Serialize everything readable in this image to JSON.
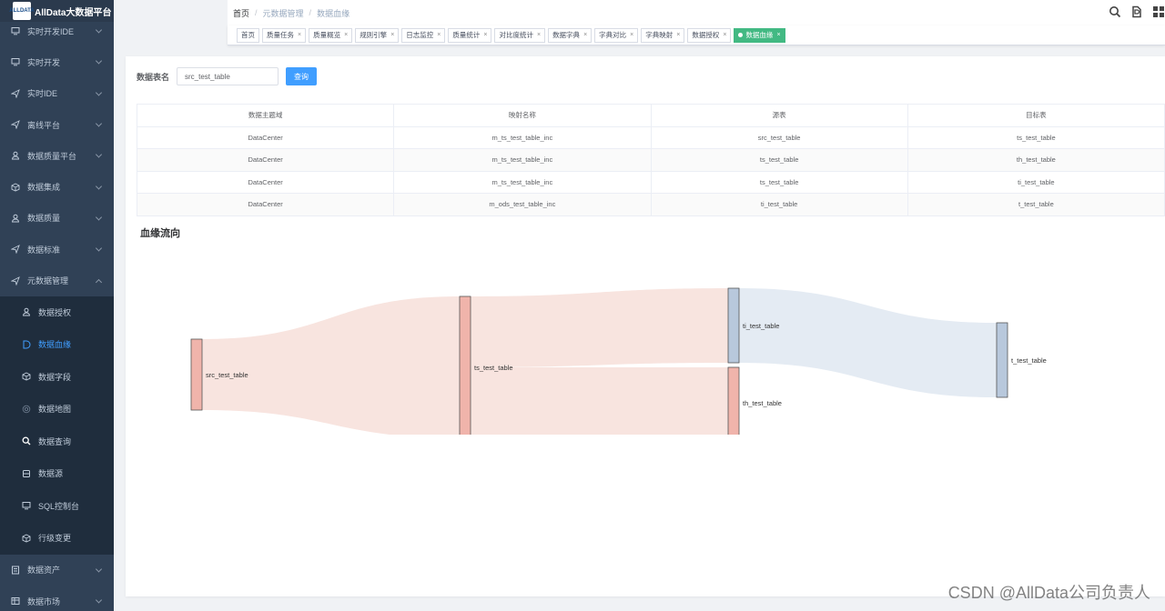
{
  "app": {
    "title": "AllData大数据平台",
    "logo_text": "ALLDATA"
  },
  "sidebar": {
    "items": [
      {
        "label": "实时开发IDE",
        "icon": "monitor-icon"
      },
      {
        "label": "实时开发",
        "icon": "monitor-icon"
      },
      {
        "label": "实时IDE",
        "icon": "send-icon"
      },
      {
        "label": "离线平台",
        "icon": "send-icon"
      },
      {
        "label": "数据质量平台",
        "icon": "user-icon"
      },
      {
        "label": "数据集成",
        "icon": "cube-icon"
      },
      {
        "label": "数据质量",
        "icon": "user-icon"
      },
      {
        "label": "数据标准",
        "icon": "send-icon"
      },
      {
        "label": "元数据管理",
        "icon": "send-icon",
        "expanded": true
      }
    ],
    "submenu": [
      {
        "label": "数据授权",
        "icon": "user-icon"
      },
      {
        "label": "数据血缘",
        "icon": "d-icon",
        "active": true
      },
      {
        "label": "数据字段",
        "icon": "cube-icon"
      },
      {
        "label": "数据地图",
        "icon": "globe-icon"
      },
      {
        "label": "数据查询",
        "icon": "search-icon"
      },
      {
        "label": "数据源",
        "icon": "database-icon"
      },
      {
        "label": "SQL控制台",
        "icon": "monitor-icon"
      },
      {
        "label": "行级变更",
        "icon": "cube-icon"
      }
    ],
    "bottom_items": [
      {
        "label": "数据资产",
        "icon": "list-icon"
      },
      {
        "label": "数据市场",
        "icon": "table-icon"
      }
    ]
  },
  "header": {
    "breadcrumb": [
      "首页",
      "元数据管理",
      "数据血缘"
    ],
    "icons": [
      "search-icon",
      "document-icon",
      "grid-icon"
    ]
  },
  "tags": [
    {
      "label": "首页",
      "closable": false
    },
    {
      "label": "质量任务",
      "closable": true
    },
    {
      "label": "质量概览",
      "closable": true
    },
    {
      "label": "规则引擎",
      "closable": true
    },
    {
      "label": "日志监控",
      "closable": true
    },
    {
      "label": "质量统计",
      "closable": true
    },
    {
      "label": "对比度统计",
      "closable": true
    },
    {
      "label": "数据字典",
      "closable": true
    },
    {
      "label": "字典对比",
      "closable": true
    },
    {
      "label": "字典映射",
      "closable": true
    },
    {
      "label": "数据授权",
      "closable": true
    },
    {
      "label": "数据血缘",
      "closable": true,
      "active": true
    }
  ],
  "search": {
    "label": "数据表名",
    "value": "src_test_table",
    "button": "查询"
  },
  "table": {
    "columns": [
      "数据主题域",
      "映射名称",
      "源表",
      "目标表"
    ],
    "rows": [
      [
        "DataCenter",
        "m_ts_test_table_inc",
        "src_test_table",
        "ts_test_table"
      ],
      [
        "DataCenter",
        "m_ts_test_table_inc",
        "ts_test_table",
        "th_test_table"
      ],
      [
        "DataCenter",
        "m_ts_test_table_inc",
        "ts_test_table",
        "ti_test_table"
      ],
      [
        "DataCenter",
        "m_ods_test_table_inc",
        "ti_test_table",
        "t_test_table"
      ]
    ]
  },
  "lineage": {
    "title": "血缘流向",
    "nodes": [
      {
        "id": "src_test_table",
        "level": 0,
        "color": "#f0b4ab"
      },
      {
        "id": "ts_test_table",
        "level": 1,
        "color": "#f0b4ab"
      },
      {
        "id": "ti_test_table",
        "level": 2,
        "color": "#b8c8dc"
      },
      {
        "id": "th_test_table",
        "level": 2,
        "color": "#f0b4ab"
      },
      {
        "id": "t_test_table",
        "level": 3,
        "color": "#b8c8dc"
      }
    ],
    "links": [
      {
        "source": "src_test_table",
        "target": "ts_test_table",
        "value": 1
      },
      {
        "source": "ts_test_table",
        "target": "ti_test_table",
        "value": 1
      },
      {
        "source": "ts_test_table",
        "target": "th_test_table",
        "value": 1
      },
      {
        "source": "ti_test_table",
        "target": "t_test_table",
        "value": 1
      }
    ],
    "link_colors": {
      "pink": "#f8e4df",
      "blue": "#e4ebf3"
    }
  },
  "watermark": "CSDN @AllData公司负责人"
}
